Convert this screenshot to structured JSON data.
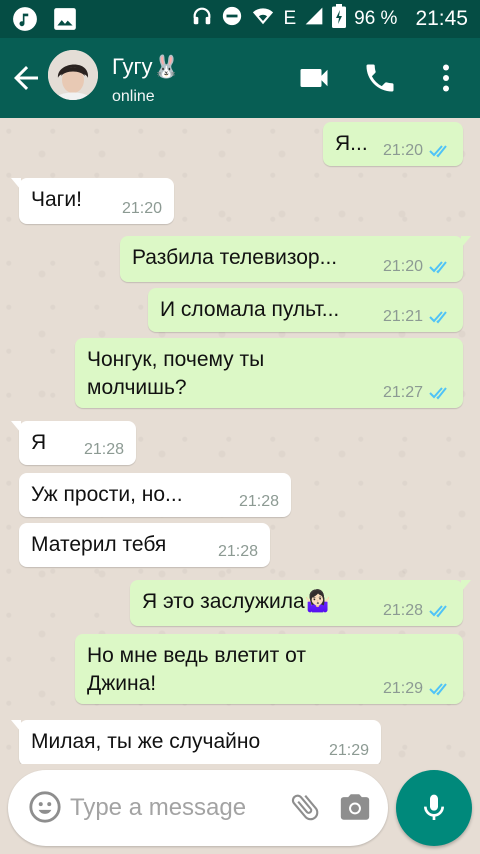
{
  "status_bar": {
    "battery": "96 %",
    "time": "21:45",
    "network": "E"
  },
  "header": {
    "contact_name": "Гугу🐰",
    "status": "online"
  },
  "messages": [
    {
      "dir": "out",
      "text": "Я...",
      "time": "21:20"
    },
    {
      "dir": "in",
      "text": "Чаги!",
      "time": "21:20"
    },
    {
      "dir": "out",
      "text": "Разбила телевизор...",
      "time": "21:20"
    },
    {
      "dir": "out",
      "text": "И сломала пульт...",
      "time": "21:21"
    },
    {
      "dir": "out",
      "text": "Чонгук, почему ты молчишь?",
      "time": "21:27"
    },
    {
      "dir": "in",
      "text": "Я",
      "time": "21:28"
    },
    {
      "dir": "in",
      "text": "Уж прости, но...",
      "time": "21:28"
    },
    {
      "dir": "in",
      "text": "Материл тебя",
      "time": "21:28"
    },
    {
      "dir": "out",
      "text": "Я это заслужила🤷🏻‍♀️",
      "time": "21:28"
    },
    {
      "dir": "out",
      "text": "Но мне ведь влетит от Джина!",
      "time": "21:29"
    },
    {
      "dir": "in",
      "text": "Милая, ты же случайно",
      "time": "21:29"
    }
  ],
  "composer": {
    "placeholder": "Type a message"
  },
  "colors": {
    "header": "#075e54",
    "status_bar": "#054d44",
    "outgoing_bubble": "#dcf8c6",
    "incoming_bubble": "#ffffff",
    "read_tick": "#4fc3f7",
    "fab": "#00897b"
  },
  "icons": {
    "status_left": [
      "music-icon",
      "image-icon"
    ],
    "status_right": [
      "headphones-icon",
      "dnd-icon",
      "wifi-icon",
      "signal-icon",
      "battery-icon"
    ],
    "header_actions": [
      "video-call-icon",
      "voice-call-icon",
      "more-vert-icon"
    ],
    "composer": [
      "emoji-icon",
      "attach-icon",
      "camera-icon",
      "mic-icon"
    ]
  }
}
